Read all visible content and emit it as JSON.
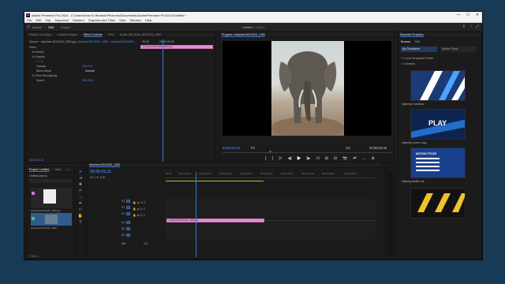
{
  "window": {
    "logo": "Pr",
    "title": "Adobe Premiere Pro 2024 - C:\\Users\\How To Browser\\Pictures\\Documents\\Adobe\\Premiere Pro\\24.0\\Untitled *",
    "minimize": "—",
    "maximize": "☐",
    "close": "✕"
  },
  "menu": [
    "File",
    "Edit",
    "Clip",
    "Sequence",
    "Markers",
    "Graphics and Titles",
    "View",
    "Window",
    "Help"
  ],
  "header": {
    "home": "⌂",
    "tabs": [
      "Import",
      "Edit",
      "Export"
    ],
    "active_tab": "Edit",
    "project_name": "Untitled",
    "project_state": "· Edited",
    "icons": [
      "share-icon",
      "progress-icon",
      "fullscreen-icon"
    ]
  },
  "source_panel": {
    "tabs": [
      "Source: (no clips)",
      "Lumetri Scopes",
      "Effect Controls",
      "Text",
      "Audio Clip Mixer: 8213429_1280"
    ],
    "active_tab": "Effect Controls",
    "source_label": "Source · elephant-8213429_1280.jpg",
    "sequence_label": "elephant-8213429_1280 · elephant-8213429...",
    "ruler_start": "00:00",
    "ruler_mid": "00:00:05:00",
    "clip_name": "elephant-8213429_1280.jpg",
    "section_video": "Video",
    "rows": [
      {
        "label": "fx  Motion"
      },
      {
        "label": "fx  Opacity"
      },
      {
        "label": "Opacity",
        "value": "100.0 %"
      },
      {
        "label": "Blend Mode",
        "value": "Normal"
      },
      {
        "label": "fx  Time Remapping"
      },
      {
        "label": "Speed",
        "value": "100.00%"
      }
    ],
    "timecode": "00:00:01:11"
  },
  "program_panel": {
    "title": "Program: elephant-8213429_1280",
    "timecode_current": "00;00;01;11",
    "fit": "Fit",
    "quality": "1/2",
    "timecode_duration": "00;00;04;29",
    "controls": [
      "{",
      "}",
      "|<",
      "◀|",
      "▶",
      "|▶",
      ">|",
      "⊞",
      "⊟",
      "📷",
      "⇄",
      "↔",
      "⊕"
    ]
  },
  "project_panel": {
    "tabs": [
      "Project: Untitled",
      "Med",
      "»"
    ],
    "active_tab": "Project: Untitled",
    "file": "Untitled.prproj",
    "items": [
      {
        "name": "elephant-8213429_1280.jpg",
        "duration": "4:29"
      },
      {
        "name": "elephant-8213429_1280",
        "duration": "4:29"
      }
    ]
  },
  "timeline": {
    "tab": "elephant-8213429_1280",
    "timecode": "00;00;01;11",
    "ruler_labels": [
      "00;00",
      "00;00;01;00",
      "00;00;02;00",
      "00;00;03;00",
      "00;00;04;00",
      "00;00;05;00",
      "00;00;06;00",
      "00;00;07;00",
      "00;00;08;00",
      "00;00;09;00"
    ],
    "video_tracks": [
      "V3",
      "V2",
      "V1"
    ],
    "audio_tracks": [
      "A1",
      "A2",
      "A3"
    ],
    "mix_label": "Mix",
    "mix_value": "0.0",
    "clip_name": "elephant-8213429_1280.jpg"
  },
  "essential_graphics": {
    "title": "Essential Graphics",
    "tabs": [
      "Browse",
      "Edit"
    ],
    "active_tab": "Browse",
    "dropdown_left": "My Templates",
    "dropdown_right": "Adobe Stock",
    "checkboxes": [
      "Local Templates Folder",
      "Libraries"
    ],
    "templates": [
      {
        "label": "Opening Transition",
        "text": ""
      },
      {
        "label": "Opening Lower Logo",
        "text": "PLAY"
      },
      {
        "label": "Opening Bullet List",
        "text": "MOTION TITLES"
      },
      {
        "label": "",
        "text": ""
      }
    ]
  },
  "colors": {
    "accent": "#3d78d6",
    "clip": "#e58ed8",
    "desktop": "#173a57"
  }
}
